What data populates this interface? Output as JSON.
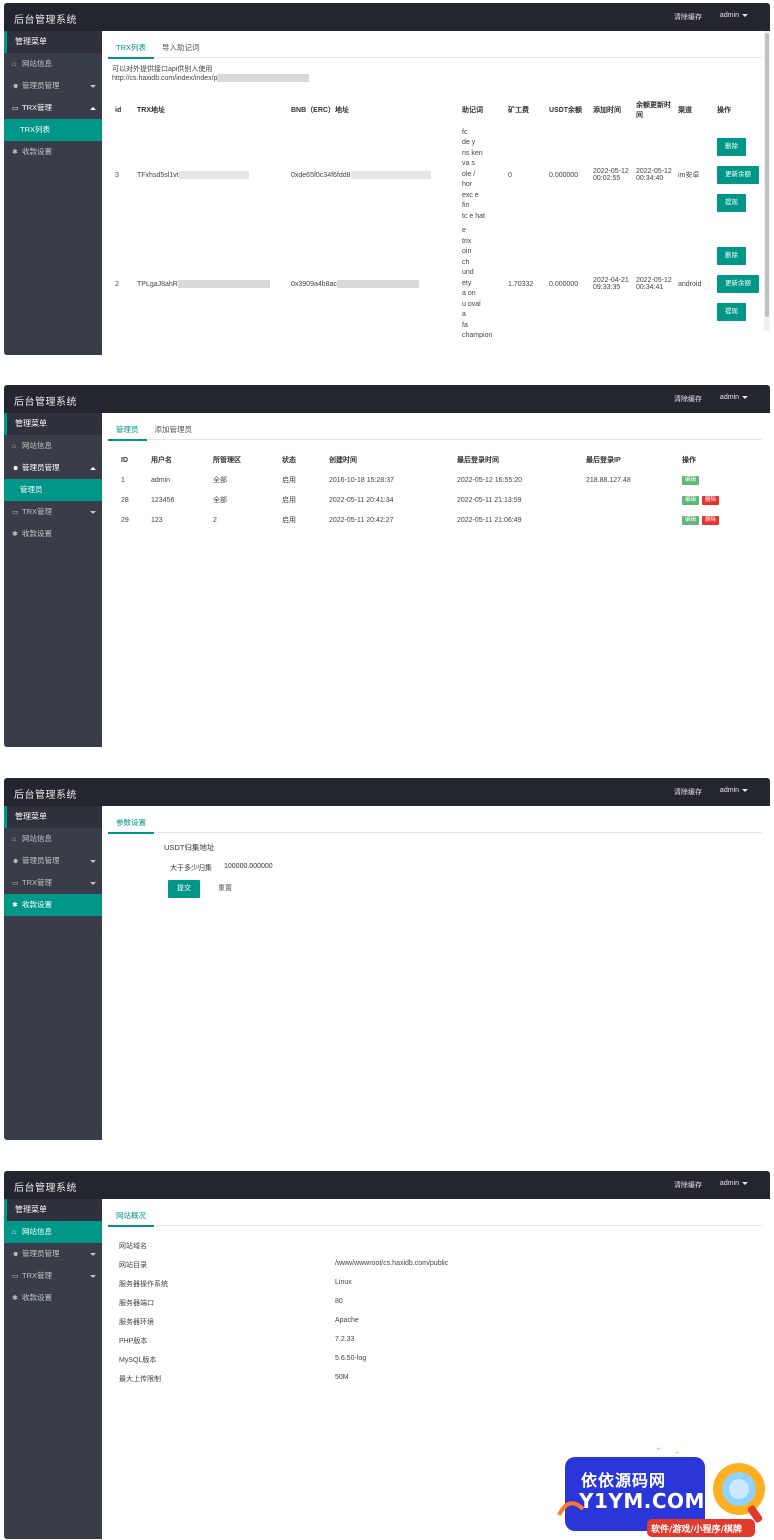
{
  "header": {
    "title": "后台管理系统",
    "clear_cache": "清除缓存",
    "user": "admin"
  },
  "sidebar": {
    "menu_title": "管理菜单",
    "site_info": "网站信息",
    "admin_mgmt": "管理员管理",
    "admin_sub": "管理员",
    "trx_mgmt": "TRX管理",
    "trx_sub": "TRX列表",
    "collect": "收款设置"
  },
  "screen1": {
    "tabs": [
      "TRX列表",
      "导入助记词"
    ],
    "notice_line1": "可以对外提供接口api供别人使用",
    "notice_line2": "http://cs.haxidb.com/index/index/p",
    "columns": [
      "id",
      "TRX地址",
      "BNB（ERC）地址",
      "助记词",
      "矿工费",
      "USDT余额",
      "添加时间",
      "余额更新时间",
      "渠道",
      "操作"
    ],
    "rows": [
      {
        "id": "3",
        "trx": "TFxhsd5sl1vt",
        "bnb": "0xde65f0c34f6fdd8",
        "mnemonic": [
          "fc",
          "de      y",
          "ris      ken",
          "va      s",
          "ole      /",
          "hor",
          "exc      e",
          "fin",
          "tc      e hat"
        ],
        "fee": "0",
        "usdt": "0.000000",
        "added": "2022-05-12 00:02:55",
        "updated": "2022-05-12 00:34:40",
        "channel": "im安卓",
        "actions": [
          "删除",
          "更新余额",
          "提现"
        ]
      },
      {
        "id": "2",
        "trx": "TPLgaJ8ahR",
        "bnb": "0x3909a4b8ac",
        "mnemonic": [
          "e",
          "trix",
          "oin",
          "ch",
          "und",
          "ety",
          "a      on",
          "u      oval",
          "a",
          "fa",
          "champion"
        ],
        "fee": "1.70332",
        "usdt": "0.000000",
        "added": "2022-04-21 09:33:35",
        "updated": "2022-05-12 00:34:41",
        "channel": "android",
        "actions": [
          "删除",
          "更新余额",
          "提现"
        ]
      }
    ]
  },
  "screen2": {
    "tabs": [
      "管理员",
      "添加管理员"
    ],
    "columns": [
      "ID",
      "用户名",
      "所管理区",
      "状态",
      "创建时间",
      "最后登录时间",
      "最后登录IP",
      "操作"
    ],
    "rows": [
      {
        "id": "1",
        "user": "admin",
        "area": "全部",
        "status": "启用",
        "created": "2016-10-18 15:28:37",
        "last": "2022-05-12 16:55:20",
        "ip": "218.88.127.48",
        "edit": "编辑",
        "del": ""
      },
      {
        "id": "28",
        "user": "123456",
        "area": "全部",
        "status": "启用",
        "created": "2022-05-11 20:41:34",
        "last": "2022-05-11 21:13:59",
        "ip": "",
        "edit": "编辑",
        "del": "删除"
      },
      {
        "id": "29",
        "user": "123",
        "area": "2",
        "status": "启用",
        "created": "2022-05-11 20:42:27",
        "last": "2022-05-11 21:06:49",
        "ip": "",
        "edit": "编辑",
        "del": "删除"
      }
    ]
  },
  "screen3": {
    "tab": "参数设置",
    "section": "USDT归集地址",
    "field_label": "大于多少归集",
    "field_value": "100000.000000",
    "submit": "提交",
    "reset": "重置"
  },
  "screen4": {
    "tab": "网站概况",
    "rows": [
      {
        "label": "网站域名",
        "value": ""
      },
      {
        "label": "网站目录",
        "value": "/www/wwwroot/cs.haxidb.com/public"
      },
      {
        "label": "服务器操作系统",
        "value": "Linux"
      },
      {
        "label": "服务器端口",
        "value": "80"
      },
      {
        "label": "服务器环境",
        "value": "Apache"
      },
      {
        "label": "PHP版本",
        "value": "7.2.33"
      },
      {
        "label": "MySQL版本",
        "value": "5.6.50-log"
      },
      {
        "label": "最大上传限制",
        "value": "50M"
      }
    ]
  },
  "watermark": {
    "line1": "依依源码网",
    "line2": "Y1YM.COM",
    "line3": "软件/游戏/小程序/棋牌"
  }
}
